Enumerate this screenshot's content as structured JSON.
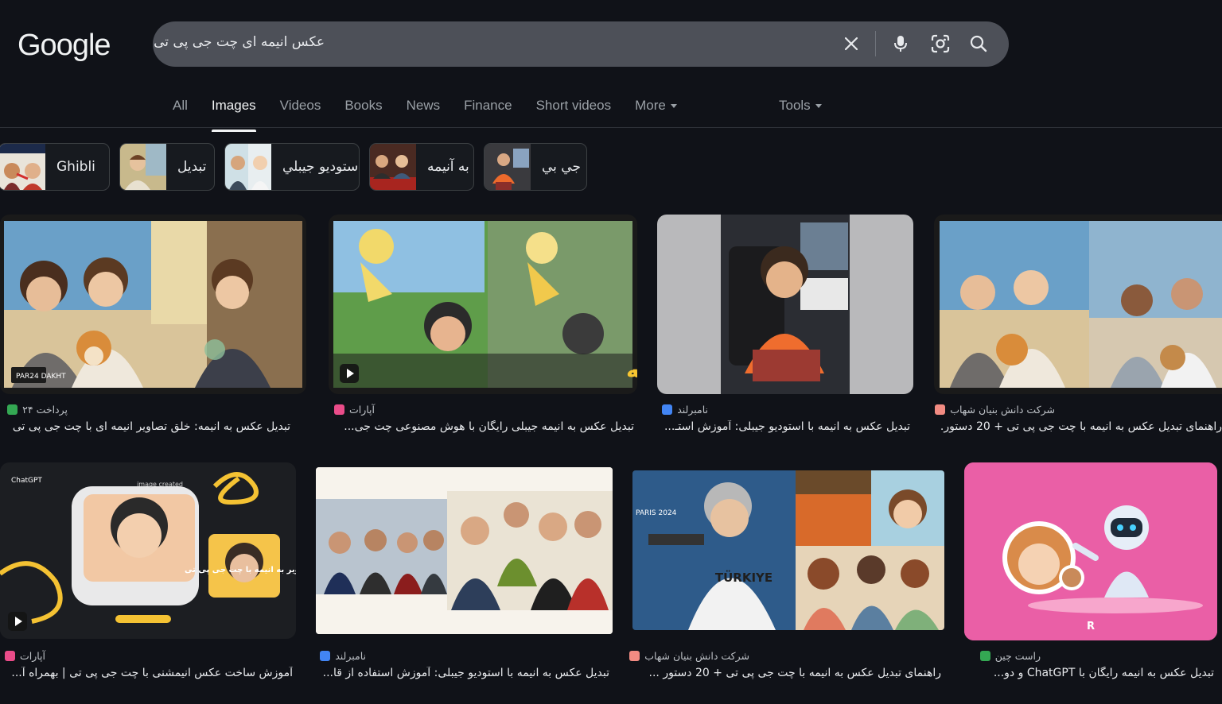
{
  "logo": "Google",
  "search": {
    "query": "عکس انیمه ای چت جی پی تی"
  },
  "tabs": [
    {
      "label": "All"
    },
    {
      "label": "Images"
    },
    {
      "label": "Videos"
    },
    {
      "label": "Books"
    },
    {
      "label": "News"
    },
    {
      "label": "Finance"
    },
    {
      "label": "Short videos"
    },
    {
      "label": "More"
    }
  ],
  "tools_label": "Tools",
  "chips": [
    {
      "label": "Ghibli"
    },
    {
      "label": "تبديل"
    },
    {
      "label": "استوديو جيبلي"
    },
    {
      "label": "به آنیمه"
    },
    {
      "label": "جي بي"
    }
  ],
  "results": [
    {
      "source": "پرداخت ۲۴",
      "title": "تبدیل عکس به انیمه: خلق تصاویر انیمه ای با چت جی پی تی",
      "favicon_color": "#34a853",
      "badge": "PAR24 DAKHT",
      "video": false
    },
    {
      "source": "آپارات",
      "title": "تبدیل عکس به انیمه جیبلی رایگان با هوش مصنوعی چت جی...",
      "favicon_color": "#ea4c89",
      "overlay": "تبدیل عکس به انیمه",
      "video": true
    },
    {
      "source": "نامبرلند",
      "title": "تبدیل عکس به انیمه با استودیو جیبلی: آموزش استـ...",
      "favicon_color": "#4285f4",
      "video": false
    },
    {
      "source": "شرکت دانش بنیان شهاب",
      "title": "راهنمای تبدیل عکس به انیمه با چت جی پی تی + 20 دستور...",
      "favicon_color": "#f28b82",
      "video": false
    },
    {
      "source": "آپارات",
      "title": "آموزش ساخت عکس انیمشنی با چت جی پی تی | بهمراه آ...",
      "favicon_color": "#ea4c89",
      "chat_label": "ChatGPT",
      "image_label": "image created",
      "overlay": "تبدیل تصاویر به انیمه با چت جی پی تی",
      "video": true
    },
    {
      "source": "نامبرلند",
      "title": "تبدیل عکس به انیمه با استودیو جیبلی: آموزش استفاده از قا...",
      "favicon_color": "#4285f4",
      "video": false
    },
    {
      "source": "شرکت دانش بنیان شهاب",
      "title": "راهنمای تبدیل عکس به انیمه با چت جی پی تی + 20 دستور ...",
      "favicon_color": "#f28b82",
      "shirt_text": "TÜRKIYE",
      "sign_text": "PARIS 2024",
      "video": false
    },
    {
      "source": "راست چین",
      "title": "تبدیل عکس به انیمه رایگان با ChatGPT و دو...",
      "favicon_color": "#34a853",
      "video": false
    }
  ],
  "colors": {
    "background": "#101218",
    "searchbox": "#4d5058",
    "text": "#e8eaed",
    "muted": "#9aa0a6"
  }
}
